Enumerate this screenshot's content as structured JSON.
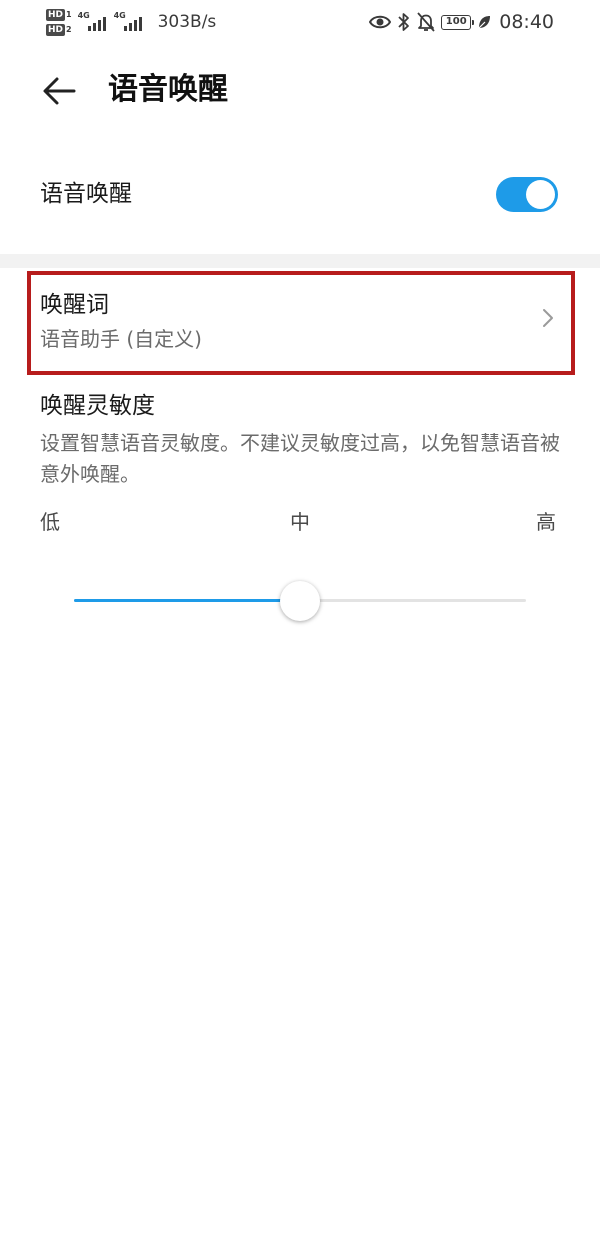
{
  "status_bar": {
    "hd1": "HD",
    "hd1_num": "1",
    "hd2": "HD",
    "hd2_num": "2",
    "network1": "4G",
    "network2": "4G",
    "speed": "303B/s",
    "battery": "100",
    "time": "08:40"
  },
  "app_bar": {
    "title": "语音唤醒"
  },
  "voice_wakeup": {
    "label": "语音唤醒",
    "enabled": true
  },
  "wake_word": {
    "title": "唤醒词",
    "value": "语音助手 (自定义)"
  },
  "sensitivity": {
    "title": "唤醒灵敏度",
    "description": "设置智慧语音灵敏度。不建议灵敏度过高，以免智慧语音被意外唤醒。",
    "ticks": {
      "low": "低",
      "mid": "中",
      "high": "高"
    },
    "level_fraction": 0.5
  },
  "colors": {
    "accent": "#1e9be8",
    "highlight": "#b71c1c"
  }
}
